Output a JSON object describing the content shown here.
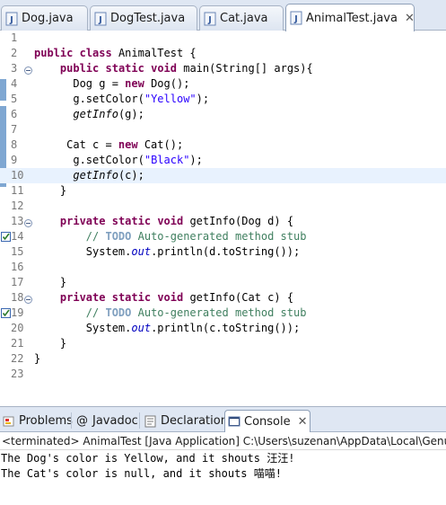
{
  "editor_tabs": [
    {
      "label": "Dog.java",
      "active": false
    },
    {
      "label": "DogTest.java",
      "active": false
    },
    {
      "label": "Cat.java",
      "active": false
    },
    {
      "label": "AnimalTest.java",
      "active": true
    }
  ],
  "editor": {
    "current_line": 10,
    "lines": [
      {
        "n": "1"
      },
      {
        "n": "2"
      },
      {
        "n": "3"
      },
      {
        "n": "4"
      },
      {
        "n": "5"
      },
      {
        "n": "6"
      },
      {
        "n": "7"
      },
      {
        "n": "8"
      },
      {
        "n": "9"
      },
      {
        "n": "10"
      },
      {
        "n": "11"
      },
      {
        "n": "12"
      },
      {
        "n": "13"
      },
      {
        "n": "14"
      },
      {
        "n": "15"
      },
      {
        "n": "16"
      },
      {
        "n": "17"
      },
      {
        "n": "18"
      },
      {
        "n": "19"
      },
      {
        "n": "20"
      },
      {
        "n": "21"
      },
      {
        "n": "22"
      },
      {
        "n": "23"
      }
    ],
    "code": {
      "l2_kw1": "public",
      "l2_kw2": "class",
      "l2_name": " AnimalTest {",
      "l3_kw1": "public",
      "l3_kw2": "static",
      "l3_kw3": "void",
      "l3_rest": " main(String[] args){",
      "l4_a": "Dog g = ",
      "l4_kw": "new",
      "l4_b": " Dog();",
      "l5_a": "g.setColor(",
      "l5_str": "\"Yellow\"",
      "l5_b": ");",
      "l6_a": "getInfo",
      "l6_b": "(g);",
      "l8_a": "Cat c = ",
      "l8_kw": "new",
      "l8_b": " Cat();",
      "l9_a": "g.setColor(",
      "l9_str": "\"Black\"",
      "l9_b": ");",
      "l10_a": "getInfo",
      "l10_b": "(c);",
      "l11": "}",
      "l13_kw1": "private",
      "l13_kw2": "static",
      "l13_kw3": "void",
      "l13_rest": " getInfo(Dog d) {",
      "l14_cm": "// ",
      "l14_todo": "TODO",
      "l14_rest": " Auto-generated method stub",
      "l15_a": "System.",
      "l15_fld": "out",
      "l15_b": ".println(d.toString());",
      "l17": "}",
      "l18_kw1": "private",
      "l18_kw2": "static",
      "l18_kw3": "void",
      "l18_rest": " getInfo(Cat c) {",
      "l19_cm": "// ",
      "l19_todo": "TODO",
      "l19_rest": " Auto-generated method stub",
      "l20_a": "System.",
      "l20_fld": "out",
      "l20_b": ".println(c.toString());",
      "l21": "}",
      "l22": "}"
    }
  },
  "view_tabs": [
    {
      "label": "Problems",
      "icon": "problems-icon",
      "active": false
    },
    {
      "label": "Javadoc",
      "icon": "at-icon",
      "active": false
    },
    {
      "label": "Declaration",
      "icon": "declaration-icon",
      "active": false
    },
    {
      "label": "Console",
      "icon": "console-icon",
      "active": true
    }
  ],
  "console": {
    "status": "<terminated> AnimalTest [Java Application] C:\\Users\\suzenan\\AppData\\Local\\Genuitec",
    "output": [
      "The Dog's color is Yellow, and it shouts 汪汪!",
      "The Cat's color is null, and it shouts 喵喵!"
    ]
  },
  "colors": {
    "keyword": "#7f0055",
    "string": "#2a00ff",
    "comment": "#3f7f5f",
    "field": "#0000c0",
    "current_line": "#e8f2fe",
    "tab_bar": "#dfe7f3"
  }
}
